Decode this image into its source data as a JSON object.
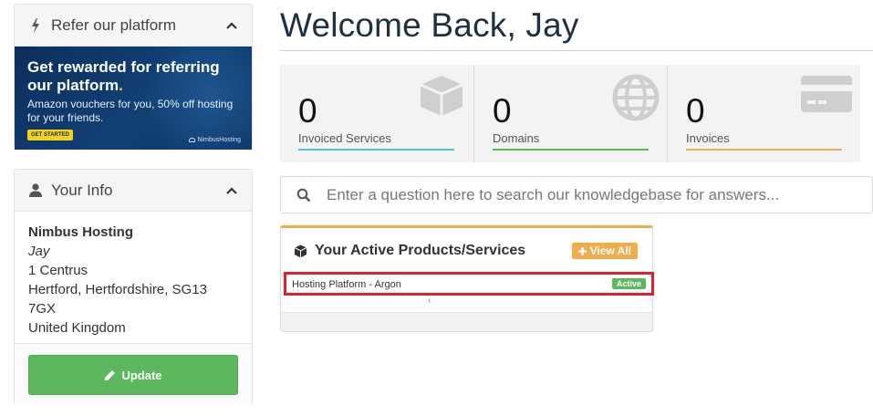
{
  "sidebar": {
    "refer": {
      "title": "Refer our platform",
      "promo": {
        "headline": "Get rewarded for referring our platform",
        "headline_dot": ".",
        "subtext": "Amazon vouchers for you, 50% off hosting for your friends.",
        "cta_label": "GET STARTED",
        "brand_label": "NimbusHosting"
      }
    },
    "your_info": {
      "title": "Your Info",
      "company": "Nimbus Hosting",
      "name": "Jay",
      "address1": "1 Centrus",
      "address2": "Hertford, Hertfordshire, SG13 7GX",
      "country": "United Kingdom",
      "update_label": "Update"
    }
  },
  "main": {
    "welcome": "Welcome Back, Jay",
    "tiles": [
      {
        "count": "0",
        "label": "Invoiced Services",
        "icon": "cube-icon",
        "accent": "#5bc0de"
      },
      {
        "count": "0",
        "label": "Domains",
        "icon": "globe-icon",
        "accent": "#5cb85c"
      },
      {
        "count": "0",
        "label": "Invoices",
        "icon": "credit-card-icon",
        "accent": "#f0ad4e"
      }
    ],
    "kb_search": {
      "placeholder": "Enter a question here to search our knowledgebase for answers..."
    },
    "products": {
      "title": "Your Active Products/Services",
      "view_all_label": "View All",
      "items": [
        {
          "name": "Hosting Platform - Argon",
          "status": "Active"
        }
      ]
    }
  },
  "colors": {
    "green": "#5cb85c",
    "orange": "#f0ad4e",
    "blue": "#5bc0de",
    "promo_bg": "#0c2f5c",
    "highlight_red": "#e2202c"
  }
}
